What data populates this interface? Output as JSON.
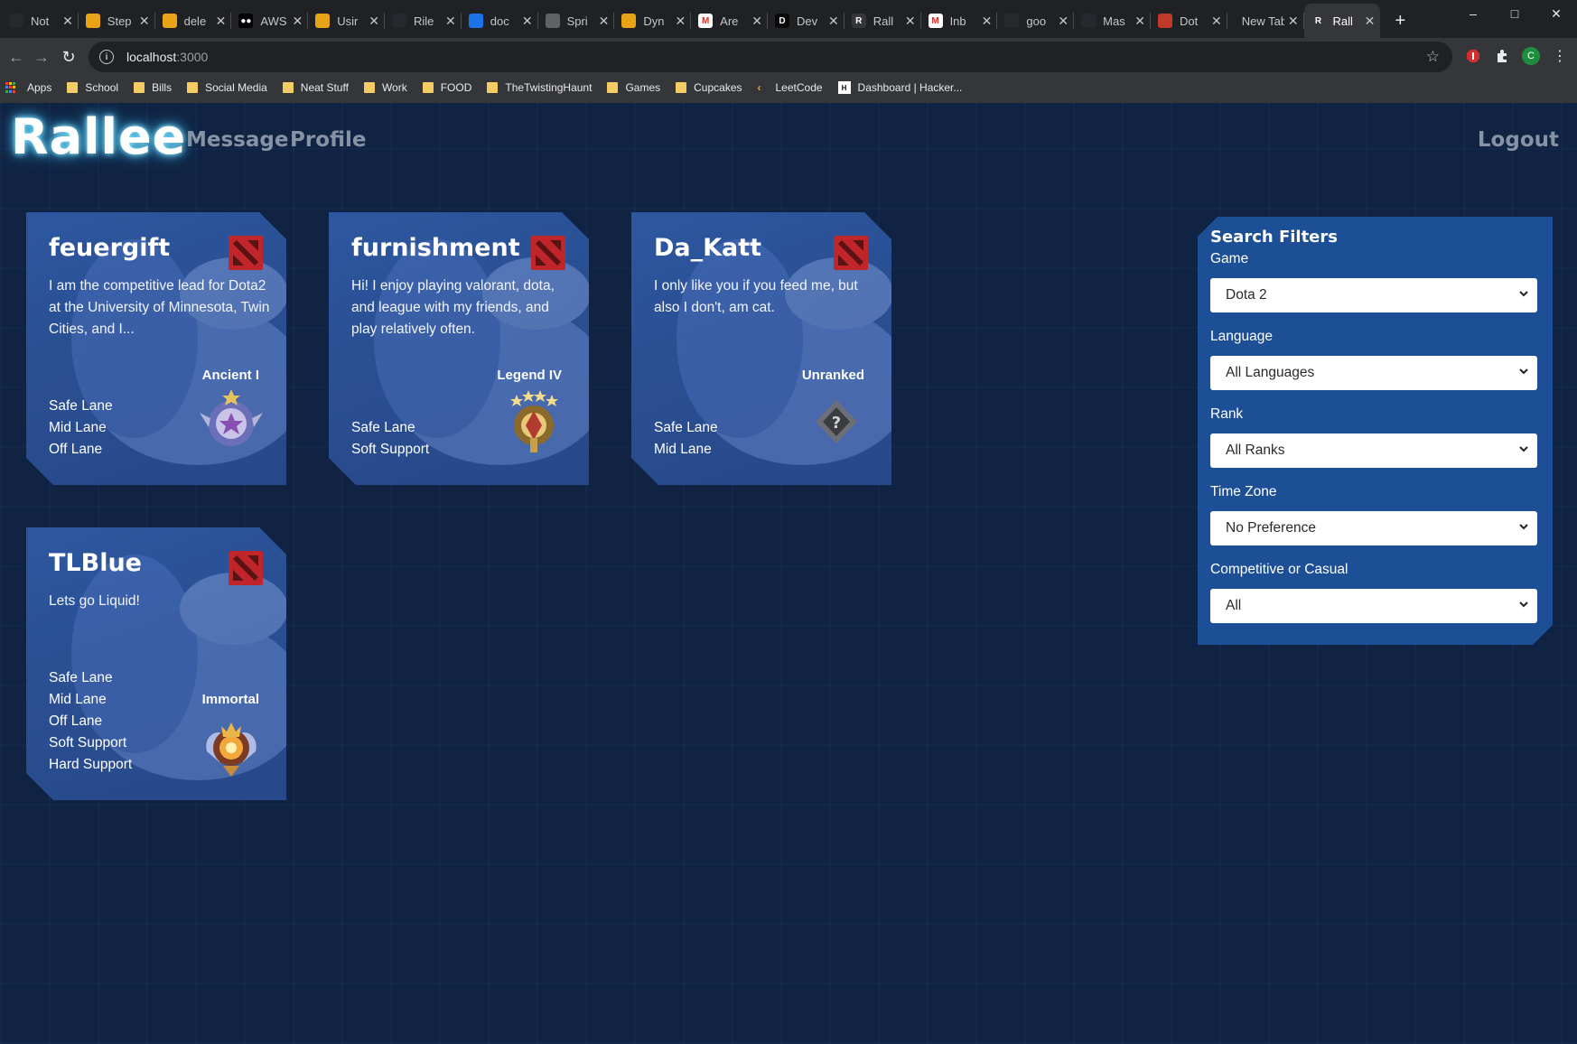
{
  "browser": {
    "tabs": [
      {
        "label": "Not",
        "fav_color": "#24292e",
        "fav_text": ""
      },
      {
        "label": "Step",
        "fav_color": "#e8a317",
        "fav_text": ""
      },
      {
        "label": "dele",
        "fav_color": "#e8a317",
        "fav_text": ""
      },
      {
        "label": "AWS",
        "fav_color": "#000000",
        "fav_text": "●●"
      },
      {
        "label": "Usir",
        "fav_color": "#e8a317",
        "fav_text": ""
      },
      {
        "label": "Rile",
        "fav_color": "#24292e",
        "fav_text": ""
      },
      {
        "label": "doc",
        "fav_color": "#1a73e8",
        "fav_text": ""
      },
      {
        "label": "Spri",
        "fav_color": "#5f6368",
        "fav_text": ""
      },
      {
        "label": "Dyn",
        "fav_color": "#e8a317",
        "fav_text": ""
      },
      {
        "label": "Are",
        "fav_color": "#ffffff",
        "fav_text": "M"
      },
      {
        "label": "Dev",
        "fav_color": "#0a0a0a",
        "fav_text": "D"
      },
      {
        "label": "Rall",
        "fav_color": "#35363a",
        "fav_text": "R"
      },
      {
        "label": "Inb",
        "fav_color": "#ffffff",
        "fav_text": "M"
      },
      {
        "label": "goo",
        "fav_color": "#24292e",
        "fav_text": ""
      },
      {
        "label": "Mas",
        "fav_color": "#24292e",
        "fav_text": ""
      },
      {
        "label": "Dot",
        "fav_color": "#c0392b",
        "fav_text": ""
      },
      {
        "label": "New Tab",
        "fav_color": "",
        "fav_text": ""
      },
      {
        "label": "Rall",
        "fav_color": "#35363a",
        "fav_text": "R"
      }
    ],
    "active_tab_index": 17,
    "url_host": "localhost",
    "url_port": ":3000",
    "profile_initial": "C",
    "bookmarks": [
      {
        "label": "Apps",
        "type": "apps"
      },
      {
        "label": "School",
        "type": "folder"
      },
      {
        "label": "Bills",
        "type": "folder"
      },
      {
        "label": "Social Media",
        "type": "folder"
      },
      {
        "label": "Neat Stuff",
        "type": "folder"
      },
      {
        "label": "Work",
        "type": "folder"
      },
      {
        "label": "FOOD",
        "type": "folder"
      },
      {
        "label": "TheTwistingHaunt",
        "type": "folder"
      },
      {
        "label": "Games",
        "type": "folder"
      },
      {
        "label": "Cupcakes",
        "type": "folder"
      },
      {
        "label": "LeetCode",
        "type": "leetcode"
      },
      {
        "label": "Dashboard | Hacker...",
        "type": "hackerrank"
      }
    ]
  },
  "app": {
    "logo": "Rallee",
    "nav": {
      "message": "Message",
      "profile": "Profile",
      "logout": "Logout"
    }
  },
  "profiles": [
    {
      "username": "feuergift",
      "description": "I am the competitive lead for Dota2 at the University of Minnesota, Twin Cities, and I...",
      "rank": "Ancient I",
      "medal": "ancient",
      "roles": [
        "Safe Lane",
        "Mid Lane",
        "Off Lane"
      ]
    },
    {
      "username": "furnishment",
      "description": "Hi! I enjoy playing valorant, dota, and league with my friends, and play relatively often.",
      "rank": "Legend IV",
      "medal": "legend",
      "roles": [
        "Safe Lane",
        "Soft Support"
      ]
    },
    {
      "username": "Da_Katt",
      "description": "I only like you if you feed me, but also I don't, am cat.",
      "rank": "Unranked",
      "medal": "unranked",
      "roles": [
        "Safe Lane",
        "Mid Lane"
      ]
    },
    {
      "username": "TLBlue",
      "description": "Lets go Liquid!",
      "rank": "Immortal",
      "medal": "immortal",
      "roles": [
        "Safe Lane",
        "Mid Lane",
        "Off Lane",
        "Soft Support",
        "Hard Support"
      ]
    }
  ],
  "filters": {
    "title": "Search Filters",
    "game": {
      "label": "Game",
      "value": "Dota 2"
    },
    "language": {
      "label": "Language",
      "value": "All Languages"
    },
    "rank": {
      "label": "Rank",
      "value": "All Ranks"
    },
    "timezone": {
      "label": "Time Zone",
      "value": "No Preference"
    },
    "competitive": {
      "label": "Competitive or Casual",
      "value": "All"
    }
  },
  "colors": {
    "page_bg": "#102342",
    "card_bg": "#2a4f92",
    "filters_bg": "#1c4f95",
    "nav_link": "#8593a4",
    "logo_glow": "#4ab8e0",
    "dota_red": "#c0252a"
  }
}
